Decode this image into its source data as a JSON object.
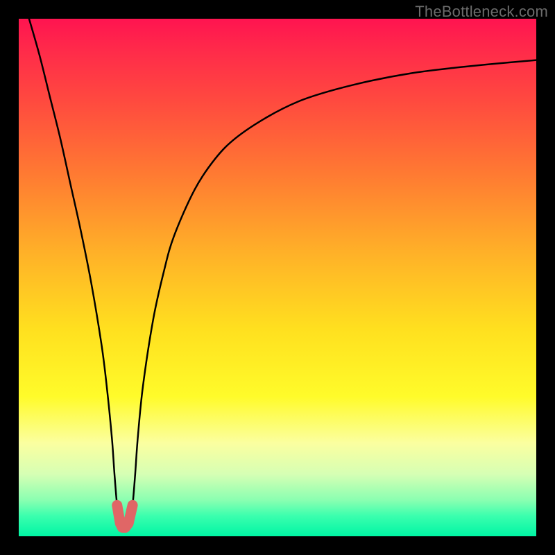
{
  "watermark": "TheBottleneck.com",
  "chart_data": {
    "type": "line",
    "title": "",
    "xlabel": "",
    "ylabel": "",
    "xlim": [
      0,
      100
    ],
    "ylim": [
      0,
      100
    ],
    "grid": false,
    "legend": false,
    "series": [
      {
        "name": "bottleneck-curve",
        "x": [
          2,
          4,
          6,
          8,
          10,
          12,
          14,
          16,
          17,
          18,
          18.5,
          19,
          19.5,
          20,
          20.5,
          21,
          21.5,
          22,
          22.5,
          23,
          24,
          26,
          28,
          30,
          34,
          38,
          42,
          48,
          54,
          60,
          68,
          76,
          84,
          92,
          100
        ],
        "y": [
          100,
          93,
          85,
          77,
          68,
          59,
          49,
          37,
          29,
          19,
          12,
          6,
          2.5,
          1.5,
          1.5,
          1.5,
          2.5,
          6,
          12,
          19,
          29,
          42,
          51,
          58,
          67,
          73,
          77,
          81,
          84,
          86,
          88,
          89.5,
          90.5,
          91.3,
          92
        ]
      }
    ],
    "markers": [
      {
        "name": "valley-left-knee",
        "x": 19.0,
        "y": 6.0
      },
      {
        "name": "valley-left-floor",
        "x": 19.6,
        "y": 2.5
      },
      {
        "name": "valley-center-1",
        "x": 20.0,
        "y": 1.7
      },
      {
        "name": "valley-center-2",
        "x": 20.6,
        "y": 1.7
      },
      {
        "name": "valley-right-floor",
        "x": 21.2,
        "y": 2.5
      },
      {
        "name": "valley-right-knee",
        "x": 22.0,
        "y": 6.0
      }
    ],
    "marker_color": "#e06666",
    "curve_color": "#000000"
  }
}
